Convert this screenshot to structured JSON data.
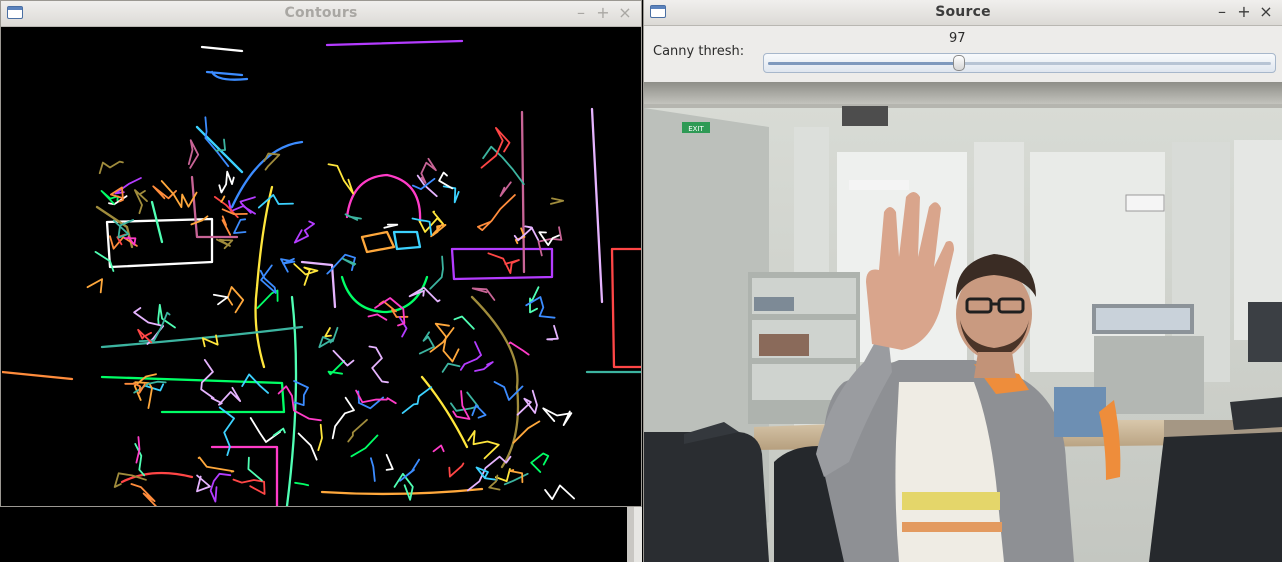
{
  "contours_window": {
    "title": "Contours",
    "controls": [
      "–",
      "+",
      "×"
    ]
  },
  "source_window": {
    "title": "Source",
    "controls": [
      "–",
      "+",
      "×"
    ],
    "trackbar": {
      "label": "Canny thresh:",
      "value": "97",
      "fraction": 0.38
    },
    "exit_sign_text": "EXIT"
  },
  "colors": {
    "title_active": "#3c3c3c",
    "title_inactive": "#a9a7a3",
    "contour_palette": [
      "#00ff66",
      "#ff3cc8",
      "#ffa83c",
      "#3cd2ff",
      "#ffffff",
      "#b43cff",
      "#ff4646",
      "#ffe63c",
      "#3c8cff",
      "#50ffb4",
      "#a08c3c",
      "#c86496",
      "#e6b4ff",
      "#3cb4a0",
      "#ff8c3c"
    ]
  }
}
